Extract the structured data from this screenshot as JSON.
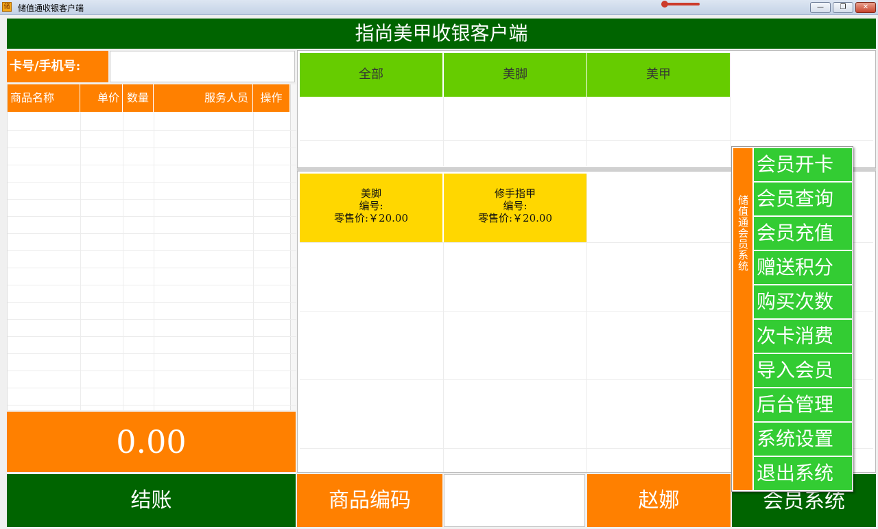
{
  "window": {
    "title": "储值通收银客户端",
    "icon_glyph": "储",
    "controls": {
      "minimize": "—",
      "restore": "❐",
      "close": "✕"
    }
  },
  "header": {
    "title": "指尚美甲收银客户端"
  },
  "card": {
    "label": "卡号/手机号:",
    "value": ""
  },
  "order_table": {
    "columns": [
      "商品名称",
      "单价",
      "数量",
      "服务人员",
      "操作"
    ],
    "rows": []
  },
  "total": {
    "amount": "0.00"
  },
  "checkout": {
    "label": "结账"
  },
  "categories": [
    "全部",
    "美脚",
    "美甲"
  ],
  "products": [
    {
      "name": "美脚",
      "code_label": "编号:",
      "price_label": "零售价:",
      "price": "￥20.00"
    },
    {
      "name": "修手指甲",
      "code_label": "编号:",
      "price_label": "零售价:",
      "price": "￥20.00"
    }
  ],
  "bottom": {
    "code_label": "商品编码",
    "code_value": "",
    "staff_name": "赵娜",
    "member_system": "会员系统"
  },
  "member_popup": {
    "side_title": "储值通会员系统",
    "items": [
      "会员开卡",
      "会员查询",
      "会员充值",
      "赠送积分",
      "购买次数",
      "次卡消费",
      "导入会员",
      "后台管理",
      "系统设置",
      "退出系统"
    ]
  },
  "colors": {
    "dark_green": "#006400",
    "orange": "#ff8000",
    "light_green": "#66cc00",
    "menu_green": "#33cc33",
    "yellow": "#ffd700"
  }
}
